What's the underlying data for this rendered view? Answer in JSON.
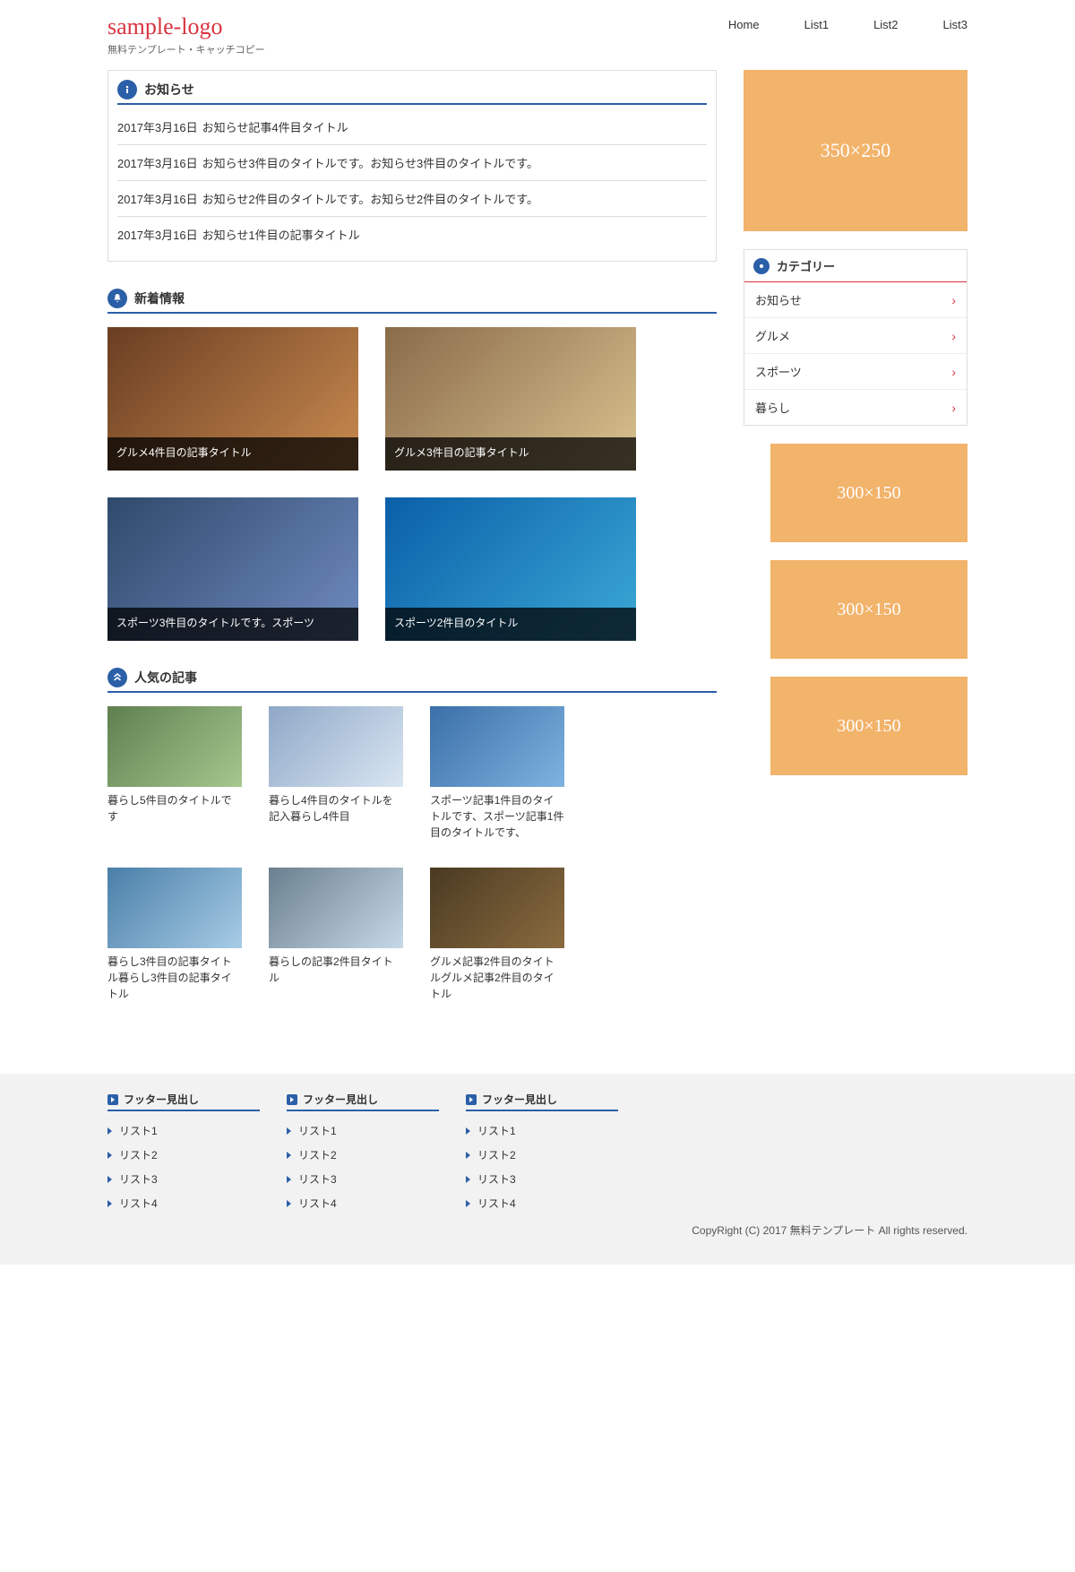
{
  "header": {
    "logo": "sample-logo",
    "tagline": "無料テンプレート・キャッチコピー",
    "nav": [
      "Home",
      "List1",
      "List2",
      "List3"
    ]
  },
  "news": {
    "heading": "お知らせ",
    "items": [
      {
        "date": "2017年3月16日",
        "title": "お知らせ記事4件目タイトル"
      },
      {
        "date": "2017年3月16日",
        "title": "お知らせ3件目のタイトルです。お知らせ3件目のタイトルです。"
      },
      {
        "date": "2017年3月16日",
        "title": "お知らせ2件目のタイトルです。お知らせ2件目のタイトルです。"
      },
      {
        "date": "2017年3月16日",
        "title": "お知らせ1件目の記事タイトル"
      }
    ]
  },
  "latest": {
    "heading": "新着情報",
    "items": [
      {
        "title": "グルメ4件目の記事タイトル",
        "img": "img-food1"
      },
      {
        "title": "グルメ3件目の記事タイトル",
        "img": "img-food2"
      },
      {
        "title": "スポーツ3件目のタイトルです。スポーツ",
        "img": "img-sport1"
      },
      {
        "title": "スポーツ2件目のタイトル",
        "img": "img-sport2"
      }
    ]
  },
  "popular": {
    "heading": "人気の記事",
    "items": [
      {
        "title": "暮らし5件目のタイトルです",
        "img": "img-life1"
      },
      {
        "title": "暮らし4件目のタイトルを記入暮らし4件目",
        "img": "img-life2"
      },
      {
        "title": "スポーツ記事1件目のタイトルです、スポーツ記事1件目のタイトルです、",
        "img": "img-life3"
      },
      {
        "title": "暮らし3件目の記事タイトル暮らし3件目の記事タイトル",
        "img": "img-life4"
      },
      {
        "title": "暮らしの記事2件目タイトル",
        "img": "img-life5"
      },
      {
        "title": "グルメ記事2件目のタイトルグルメ記事2件目のタイトル",
        "img": "img-food3"
      }
    ]
  },
  "sidebar": {
    "ad1": "350×250",
    "categories_heading": "カテゴリー",
    "categories": [
      "お知らせ",
      "グルメ",
      "スポーツ",
      "暮らし"
    ],
    "ads": [
      "300×150",
      "300×150",
      "300×150"
    ]
  },
  "footer": {
    "cols": [
      {
        "heading": "フッター見出し",
        "items": [
          "リスト1",
          "リスト2",
          "リスト3",
          "リスト4"
        ]
      },
      {
        "heading": "フッター見出し",
        "items": [
          "リスト1",
          "リスト2",
          "リスト3",
          "リスト4"
        ]
      },
      {
        "heading": "フッター見出し",
        "items": [
          "リスト1",
          "リスト2",
          "リスト3",
          "リスト4"
        ]
      }
    ],
    "copyright": "CopyRight (C) 2017 無料テンプレート All rights reserved."
  }
}
